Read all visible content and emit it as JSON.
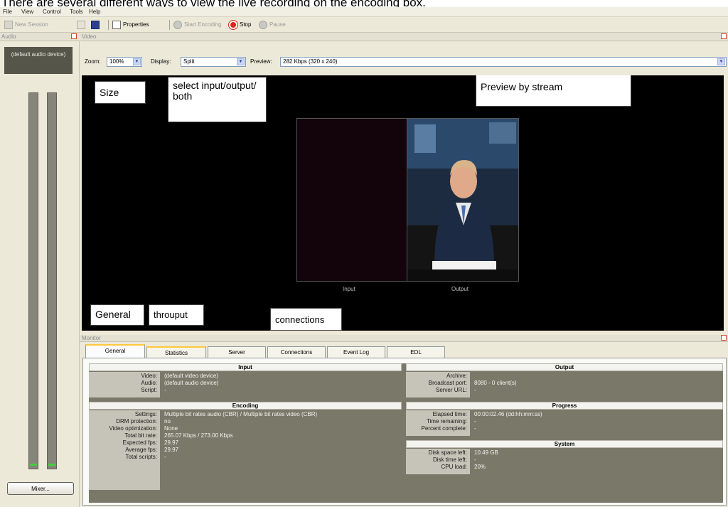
{
  "caption": "There are several different ways to view the live recording on the encoding box.",
  "menu": [
    "File",
    "View",
    "Control",
    "Tools",
    "Help"
  ],
  "toolbar": {
    "new_session": "New Session",
    "properties": "Properties",
    "start_encoding": "Start Encoding",
    "stop": "Stop",
    "pause": "Pause"
  },
  "panels": {
    "audio": "Audio",
    "video": "Video",
    "monitor": "Monitor"
  },
  "audio": {
    "device": "(default audio device)",
    "mixer_button": "Mixer..."
  },
  "video_toolbar": {
    "zoom_label": "Zoom:",
    "zoom_value": "100%",
    "display_label": "Display:",
    "display_value": "Split",
    "preview_label": "Preview:",
    "preview_value": "282 Kbps (320 x 240)"
  },
  "annotations": {
    "size": "Size",
    "select": "select input/output/ both",
    "preview_by_stream": "Preview by stream",
    "general": "General",
    "throughput": "throuput",
    "connections": "connections"
  },
  "panes": {
    "input": "Input",
    "output": "Output"
  },
  "monitor_tabs": [
    "General",
    "Statistics",
    "Server",
    "Connections",
    "Event Log",
    "EDL"
  ],
  "input_group": {
    "title": "Input",
    "rows": [
      {
        "label": "Video:",
        "value": "(default video device)"
      },
      {
        "label": "Audio:",
        "value": "(default audio device)"
      },
      {
        "label": "Script:",
        "value": "-"
      }
    ]
  },
  "encoding_group": {
    "title": "Encoding",
    "rows": [
      {
        "label": "Settings:",
        "value": "Multiple bit rates audio (CBR) / Multiple bit rates video (CBR)"
      },
      {
        "label": "DRM protection:",
        "value": "no"
      },
      {
        "label": "Video optimization:",
        "value": "None"
      },
      {
        "label": "Total bit rate:",
        "value": "265.07 Kbps / 273.00 Kbps"
      },
      {
        "label": "Expected fps:",
        "value": "29.97"
      },
      {
        "label": "Average fps:",
        "value": "29.97"
      },
      {
        "label": "Total scripts:",
        "value": "-"
      }
    ]
  },
  "output_group": {
    "title": "Output",
    "rows": [
      {
        "label": "Archive:",
        "value": ""
      },
      {
        "label": "Broadcast port:",
        "value": "8080 - 0 client(s)"
      },
      {
        "label": "Server URL:",
        "value": "-"
      }
    ]
  },
  "progress_group": {
    "title": "Progress",
    "rows": [
      {
        "label": "Elapsed time:",
        "value": "00:00:02.46  (dd:hh:mm:ss)"
      },
      {
        "label": "Time remaining:",
        "value": "-"
      },
      {
        "label": "Percent complete:",
        "value": "-"
      }
    ]
  },
  "system_group": {
    "title": "System",
    "rows": [
      {
        "label": "Disk space left:",
        "value": "10.49 GB"
      },
      {
        "label": "Disk time left:",
        "value": "-"
      },
      {
        "label": "CPU load:",
        "value": "20%"
      }
    ]
  },
  "colors": {
    "video_bg": "#000000",
    "panel_bg": "#ece9d8",
    "stats_bg": "#7a7869",
    "meter_level": "#3fd13a",
    "stop_icon": "#d9281b",
    "tab_highlight": "#ffc83c"
  }
}
